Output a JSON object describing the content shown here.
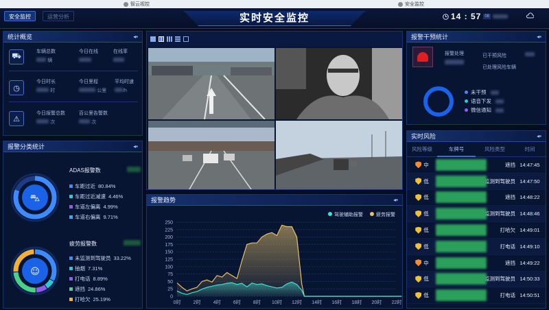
{
  "browser_strip": {
    "left_tab": "智云视控",
    "right_tab": "安全监控"
  },
  "header": {
    "tabs": [
      "安全监控",
      "运营分析"
    ],
    "title": "实时安全监控",
    "time": "14 : 57",
    "secs": "08"
  },
  "stats_overview": {
    "title": "统计概览",
    "row1": {
      "label1": "车辆总数",
      "unit1": "辆",
      "label2": "今日在线",
      "label3": "在线率"
    },
    "row2": {
      "label1": "今日时长",
      "unit1": "时",
      "label2": "今日里程",
      "unit2": "公里",
      "label3": "平均时速",
      "unit3": "/h"
    },
    "row3": {
      "label1": "今日报警总数",
      "unit1": "次",
      "label2": "百公里告警数",
      "unit2": "次"
    }
  },
  "alarm_category": {
    "title": "报警分类统计",
    "adas_title": "ADAS报警数",
    "adas_items": [
      {
        "label": "车距过近",
        "pct": "80.84%",
        "color": "#3d8bff"
      },
      {
        "label": "车距过近减速",
        "pct": "4.46%",
        "color": "#28c9d8"
      },
      {
        "label": "车道左偏离",
        "pct": "4.99%",
        "color": "#8e5cf0"
      },
      {
        "label": "车道右偏离",
        "pct": "9.71%",
        "color": "#3aa7ff"
      }
    ],
    "fatigue_title": "疲劳报警数",
    "fatigue_items": [
      {
        "label": "未监测到驾驶员",
        "pct": "33.22%",
        "color": "#3d8bff"
      },
      {
        "label": "抽烟",
        "pct": "7.31%",
        "color": "#28c9d8"
      },
      {
        "label": "打电话",
        "pct": "8.89%",
        "color": "#8e5cf0"
      },
      {
        "label": "遮挡",
        "pct": "24.86%",
        "color": "#4bd08a"
      },
      {
        "label": "打哈欠",
        "pct": "25.19%",
        "color": "#f0b03c"
      }
    ]
  },
  "alarm_trend": {
    "title": "报警趋势",
    "legend": [
      "驾驶辅助报警",
      "疲劳报警"
    ]
  },
  "chart_data": {
    "type": "area",
    "x": [
      "0时",
      "2时",
      "4时",
      "6时",
      "8时",
      "10时",
      "12时",
      "14时",
      "16时",
      "18时",
      "20时",
      "22时"
    ],
    "ylim": [
      0,
      250
    ],
    "yticks": [
      0,
      25,
      50,
      75,
      100,
      125,
      150,
      175,
      200,
      225,
      250
    ],
    "series": [
      {
        "name": "驾驶辅助报警",
        "color": "#3fe0d0",
        "points": [
          [
            0,
            18
          ],
          [
            1,
            10
          ],
          [
            2,
            6
          ],
          [
            3,
            12
          ],
          [
            4,
            16
          ],
          [
            5,
            24
          ],
          [
            6,
            30
          ],
          [
            7,
            34
          ],
          [
            8,
            38
          ],
          [
            9,
            40
          ],
          [
            10,
            44
          ],
          [
            11,
            46
          ],
          [
            12,
            40
          ],
          [
            13,
            44
          ],
          [
            14,
            32
          ],
          [
            15,
            45
          ],
          [
            16,
            40
          ],
          [
            17,
            42
          ],
          [
            18,
            36
          ],
          [
            19,
            32
          ],
          [
            20,
            28
          ],
          [
            21,
            30
          ],
          [
            22,
            42
          ],
          [
            23,
            48
          ],
          [
            24,
            40
          ],
          [
            25,
            20
          ],
          [
            25.5,
            0
          ],
          [
            45,
            0
          ]
        ]
      },
      {
        "name": "疲劳报警",
        "color": "#e8c168",
        "points": [
          [
            0,
            45
          ],
          [
            1,
            30
          ],
          [
            2,
            18
          ],
          [
            3,
            25
          ],
          [
            4,
            30
          ],
          [
            5,
            50
          ],
          [
            6,
            55
          ],
          [
            7,
            48
          ],
          [
            8,
            70
          ],
          [
            9,
            65
          ],
          [
            10,
            80
          ],
          [
            11,
            70
          ],
          [
            12,
            60
          ],
          [
            13,
            120
          ],
          [
            14,
            175
          ],
          [
            15,
            180
          ],
          [
            16,
            180
          ],
          [
            17,
            200
          ],
          [
            18,
            210
          ],
          [
            19,
            215
          ],
          [
            20,
            205
          ],
          [
            21,
            240
          ],
          [
            22,
            235
          ],
          [
            23,
            235
          ],
          [
            24,
            200
          ],
          [
            25,
            40
          ],
          [
            25.5,
            0
          ],
          [
            45,
            0
          ]
        ]
      }
    ]
  },
  "intervention": {
    "title": "报警干预统计",
    "handle_label": "报警处理",
    "prewarn_label": "已干预风险",
    "handled_label": "已处理风险车辆",
    "legend": [
      {
        "label": "未干预",
        "color": "#3d8bff"
      },
      {
        "label": "语音下发",
        "color": "#28c9d8"
      },
      {
        "label": "微信通知",
        "color": "#8e5cf0"
      }
    ]
  },
  "realtime_risk": {
    "title": "实时风险",
    "columns": [
      "风险等级",
      "车牌号",
      "风险类型",
      "时间"
    ],
    "rows": [
      {
        "level": "中",
        "level_color": "#ff8a2a",
        "type": "遮挡",
        "time": "14:47:45"
      },
      {
        "level": "低",
        "level_color": "#f2c230",
        "type": "未监测到驾驶员",
        "time": "14:47:50"
      },
      {
        "level": "低",
        "level_color": "#f2c230",
        "type": "遮挡",
        "time": "14:48:22"
      },
      {
        "level": "低",
        "level_color": "#f2c230",
        "type": "未监测到驾驶员",
        "time": "14:48:46"
      },
      {
        "level": "低",
        "level_color": "#f2c230",
        "type": "打哈欠",
        "time": "14:49:01"
      },
      {
        "level": "低",
        "level_color": "#f2c230",
        "type": "打电话",
        "time": "14:49:10"
      },
      {
        "level": "中",
        "level_color": "#ff8a2a",
        "type": "遮挡",
        "time": "14:49:22"
      },
      {
        "level": "低",
        "level_color": "#f2c230",
        "type": "未监测到驾驶员",
        "time": "14:50:33"
      },
      {
        "level": "低",
        "level_color": "#f2c230",
        "type": "打电话",
        "time": "14:50:51"
      }
    ]
  }
}
